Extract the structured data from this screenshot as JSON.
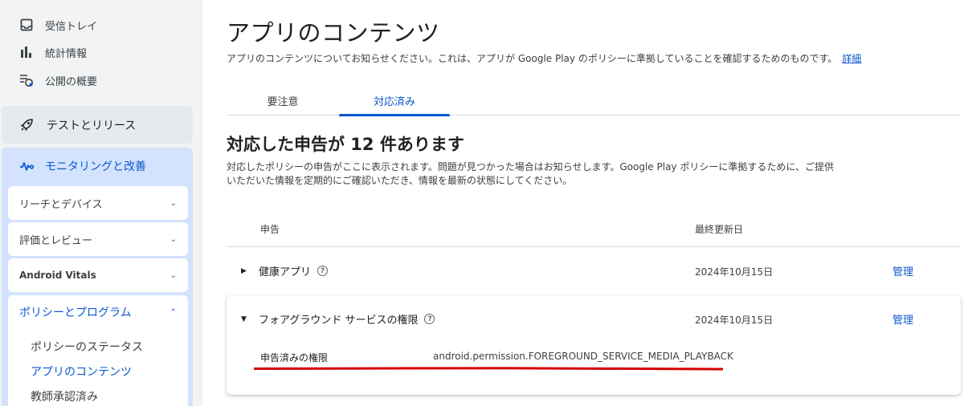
{
  "sidebar": {
    "top_items": [
      {
        "label": "受信トレイ",
        "icon": "inbox-icon"
      },
      {
        "label": "統計情報",
        "icon": "bar-chart-icon"
      },
      {
        "label": "公開の概要",
        "icon": "publishing-overview-icon"
      }
    ],
    "test_release": {
      "label": "テストとリリース",
      "icon": "rocket-icon"
    },
    "monitoring": {
      "label": "モニタリングと改善",
      "icon": "pulse-icon",
      "subsections": [
        {
          "label": "リーチとデバイス"
        },
        {
          "label": "評価とレビュー"
        },
        {
          "label": "Android Vitals"
        }
      ],
      "policy": {
        "label": "ポリシーとプログラム",
        "items": [
          "ポリシーのステータス",
          "アプリのコンテンツ",
          "教師承認済み"
        ],
        "active_index": 1
      }
    }
  },
  "main": {
    "title": "アプリのコンテンツ",
    "description": "アプリのコンテンツについてお知らせください。これは、アプリが Google Play のポリシーに準拠していることを確認するためのものです。",
    "details_link": "詳細",
    "tabs": [
      {
        "label": "要注意",
        "active": false
      },
      {
        "label": "対応済み",
        "active": true
      }
    ],
    "section_title": "対応した申告が 12 件あります",
    "section_desc_line1": "対応したポリシーの申告がここに表示されます。問題が見つかった場合はお知らせします。Google Play ポリシーに準拠するために、ご提供",
    "section_desc_line2": "いただいた情報を定期的にご確認いただき、情報を最新の状態にしてください。",
    "table": {
      "col_declaration": "申告",
      "col_updated": "最終更新日",
      "rows": [
        {
          "label": "健康アプリ",
          "date": "2024年10月15日",
          "action": "管理",
          "expanded": false
        },
        {
          "label": "フォアグラウンド サービスの権限",
          "date": "2024年10月15日",
          "action": "管理",
          "expanded": true,
          "detail_label": "申告済みの権限",
          "detail_value": "android.permission.FOREGROUND_SERVICE_MEDIA_PLAYBACK"
        }
      ]
    }
  },
  "colors": {
    "accent": "#0b57d0",
    "annotation_red": "#d50000",
    "sidebar_bg": "#f1f3f4",
    "active_section_bg": "#d3e3fd"
  }
}
